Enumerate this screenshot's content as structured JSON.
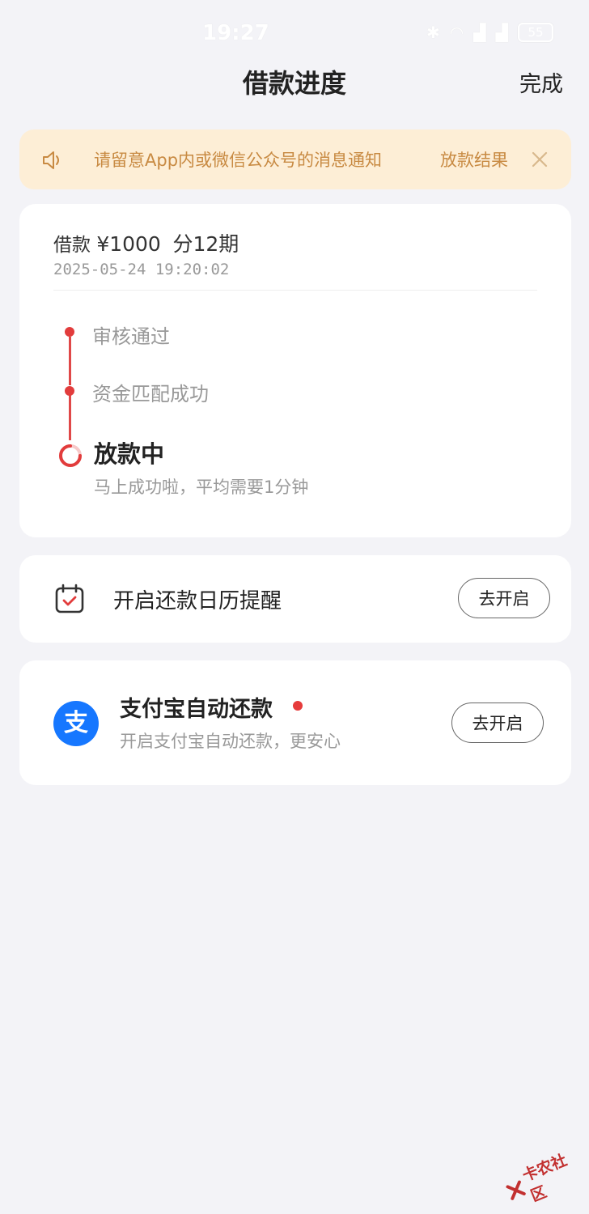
{
  "status_bar": {
    "time": "19:27",
    "battery": "55"
  },
  "nav": {
    "title": "借款进度",
    "done_label": "完成"
  },
  "notice": {
    "text": "请留意App内或微信公众号的消息通知",
    "text_tail": "放款结果",
    "icon": "speaker-icon",
    "close_icon": "close-icon"
  },
  "loan": {
    "title_prefix": "借款",
    "amount": "¥1000",
    "term": "分12期",
    "created_at": "2025-05-24 19:20:02"
  },
  "progress": {
    "steps": [
      {
        "label": "审核通过"
      },
      {
        "label": "资金匹配成功"
      }
    ],
    "current": {
      "label": "放款中",
      "desc": "马上成功啦，平均需要1分钟"
    }
  },
  "calendar_reminder": {
    "label": "开启还款日历提醒",
    "button": "去开启",
    "icon": "calendar-check-icon"
  },
  "alipay": {
    "logo_text": "支",
    "title": "支付宝自动还款",
    "desc": "开启支付宝自动还款，更安心",
    "button": "去开启"
  },
  "watermark": {
    "text": "卡农社区"
  },
  "colors": {
    "background": "#f3f3f7",
    "accent_red": "#e23c3c",
    "notice_bg": "#fdeed6",
    "notice_text": "#c88a42",
    "alipay_blue": "#1677ff"
  }
}
